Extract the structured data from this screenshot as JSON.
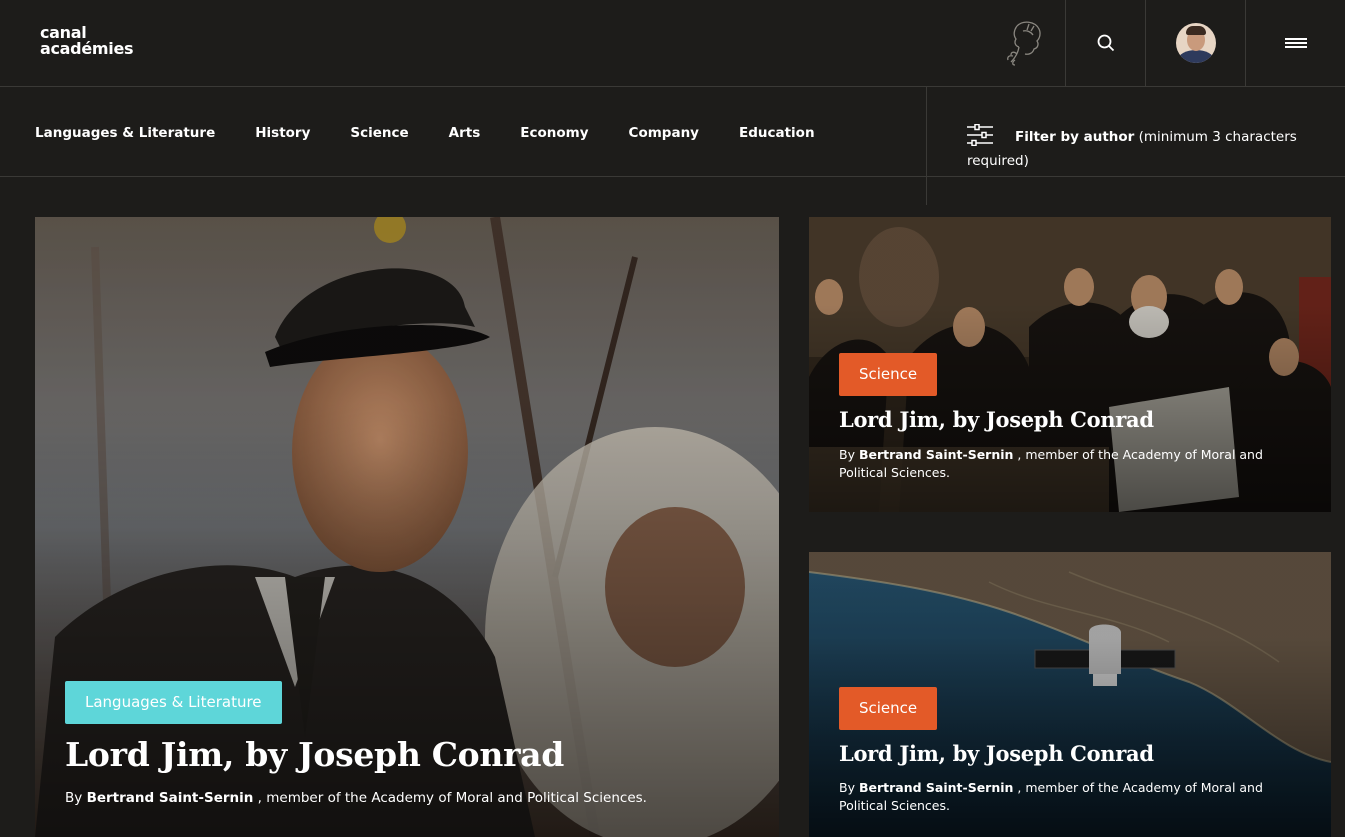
{
  "brand": {
    "line1": "canal",
    "line2": "académies"
  },
  "header": {
    "icons": [
      "emblem-icon",
      "search-icon",
      "avatar",
      "menu-icon"
    ]
  },
  "nav": {
    "items": [
      "Languages & Literature",
      "History",
      "Science",
      "Arts",
      "Economy",
      "Company",
      "Education"
    ]
  },
  "filter": {
    "label": "Filter by author",
    "hint": "(minimum 3 characters required)"
  },
  "cards": [
    {
      "tag": "Languages & Literature",
      "tag_color": "#5ed6d9",
      "title": "Lord Jim, by Joseph Conrad",
      "by": "By",
      "author": "Bertrand Saint-Sernin",
      "role": ", member of the Academy of Moral and Political Sciences."
    },
    {
      "tag": "Science",
      "tag_color": "#e35a28",
      "title": "Lord Jim, by Joseph Conrad",
      "by": "By",
      "author": "Bertrand Saint-Sernin",
      "role": ", member of the Academy of Moral and Political Sciences."
    },
    {
      "tag": "Science",
      "tag_color": "#e35a28",
      "title": "Lord Jim, by Joseph Conrad",
      "by": "By",
      "author": "Bertrand Saint-Sernin",
      "role": ", member of the Academy of Moral and Political Sciences."
    }
  ]
}
